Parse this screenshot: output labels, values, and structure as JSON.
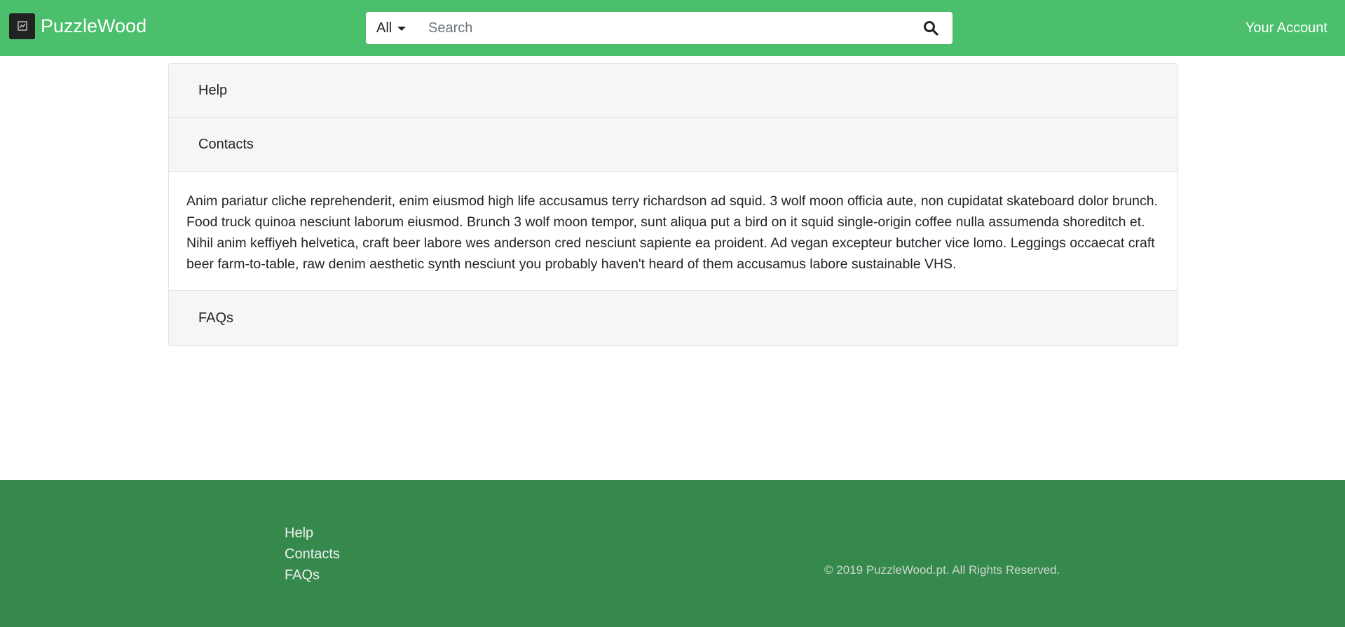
{
  "header": {
    "brand": "PuzzleWood",
    "search": {
      "category": "All",
      "placeholder": "Search",
      "value": ""
    },
    "account_label": "Your Account"
  },
  "accordion": {
    "sections": [
      {
        "title": "Help",
        "expanded": false
      },
      {
        "title": "Contacts",
        "expanded": true
      },
      {
        "title": "FAQs",
        "expanded": false
      }
    ],
    "body_text": "Anim pariatur cliche reprehenderit, enim eiusmod high life accusamus terry richardson ad squid. 3 wolf moon officia aute, non cupidatat skateboard dolor brunch. Food truck quinoa nesciunt laborum eiusmod. Brunch 3 wolf moon tempor, sunt aliqua put a bird on it squid single-origin coffee nulla assumenda shoreditch et. Nihil anim keffiyeh helvetica, craft beer labore wes anderson cred nesciunt sapiente ea proident. Ad vegan excepteur butcher vice lomo. Leggings occaecat craft beer farm-to-table, raw denim aesthetic synth nesciunt you probably haven't heard of them accusamus labore sustainable VHS."
  },
  "footer": {
    "links": [
      "Help",
      "Contacts",
      "FAQs"
    ],
    "copyright": "© 2019 PuzzleWood.pt. All Rights Reserved."
  },
  "colors": {
    "navbar": "#4bbf6b",
    "footer": "#36894c",
    "panel_header": "#f6f6f6"
  },
  "icons": {
    "logo": "broken-image-icon",
    "search": "search-icon",
    "dropdown": "caret-down-icon"
  }
}
